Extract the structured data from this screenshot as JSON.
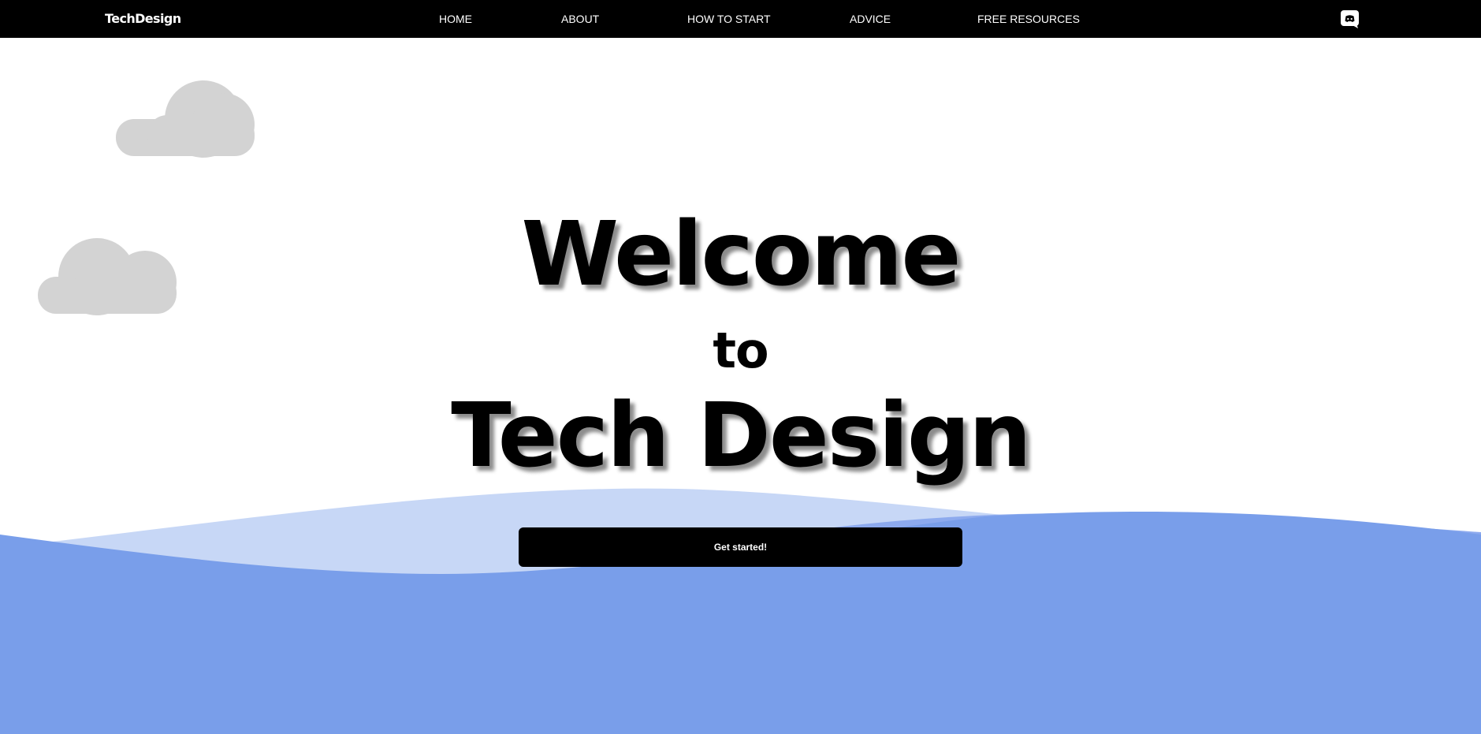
{
  "navbar": {
    "brand": "TechDesign",
    "links": [
      {
        "label": "HOME"
      },
      {
        "label": "ABOUT"
      },
      {
        "label": "HOW TO START"
      },
      {
        "label": "ADVICE"
      },
      {
        "label": "FREE RESOURCES"
      }
    ],
    "discord_icon": "discord-icon"
  },
  "hero": {
    "line1": "Welcome",
    "line2": "to",
    "line3": "Tech Design"
  },
  "cta": {
    "label": "Get started!"
  },
  "colors": {
    "navbar_bg": "#000000",
    "cloud": "#d3d3d3",
    "wave_light": "#c7d7f6",
    "wave_mid": "#8daaee",
    "wave_dark": "#799eea",
    "button_bg": "#000000"
  },
  "decorations": {
    "clouds": [
      "cloud-icon",
      "cloud-icon"
    ]
  }
}
